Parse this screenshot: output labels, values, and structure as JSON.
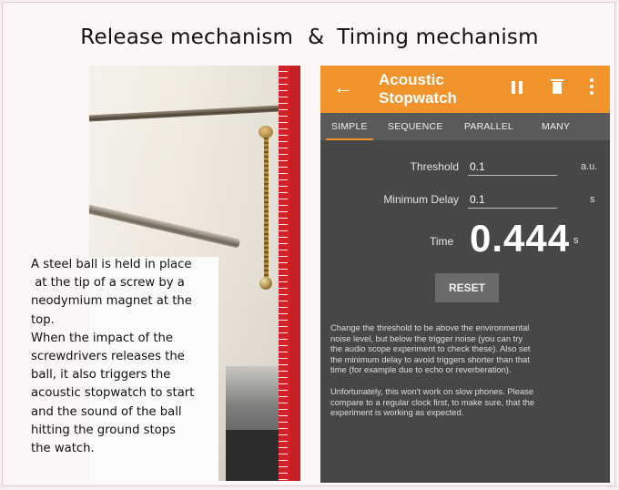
{
  "heading": {
    "left": "Release mechanism",
    "amp": "&",
    "right": "Timing mechanism"
  },
  "caption_lines": [
    "A steel ball is held in place",
    " at the tip of a screw by a",
    "neodymium magnet at the",
    "top.",
    "When the impact of the",
    "screwdrivers releases the",
    "ball, it also triggers the",
    "acoustic stopwatch to start",
    "and the sound of the ball",
    "hitting the ground stops",
    "the watch."
  ],
  "app": {
    "title_line1": "Acoustic",
    "title_line2": "Stopwatch",
    "back_icon": "←",
    "accent_color": "#f2942b",
    "tabs": [
      "SIMPLE",
      "SEQUENCE",
      "PARALLEL",
      "MANY"
    ],
    "threshold_label": "Threshold",
    "threshold_value": "0.1",
    "threshold_unit": "a.u.",
    "delay_label": "Minimum Delay",
    "delay_value": "0.1",
    "delay_unit": "s",
    "time_label": "Time",
    "time_value": "0.444",
    "time_unit": "s",
    "reset_label": "RESET",
    "help1": [
      "Change the threshold to be above the environmental",
      "noise level, but below the trigger noise (you can try",
      "the audio scope experiment to check these). Also set",
      "the minimum delay to avoid triggers shorter than that",
      "time (for example due to echo or reverberation)."
    ],
    "help2": [
      "Unfortunately, this won't work on slow phones. Please",
      "compare to a regular clock first, to make sure, that the",
      "experiment is working as expected."
    ]
  }
}
